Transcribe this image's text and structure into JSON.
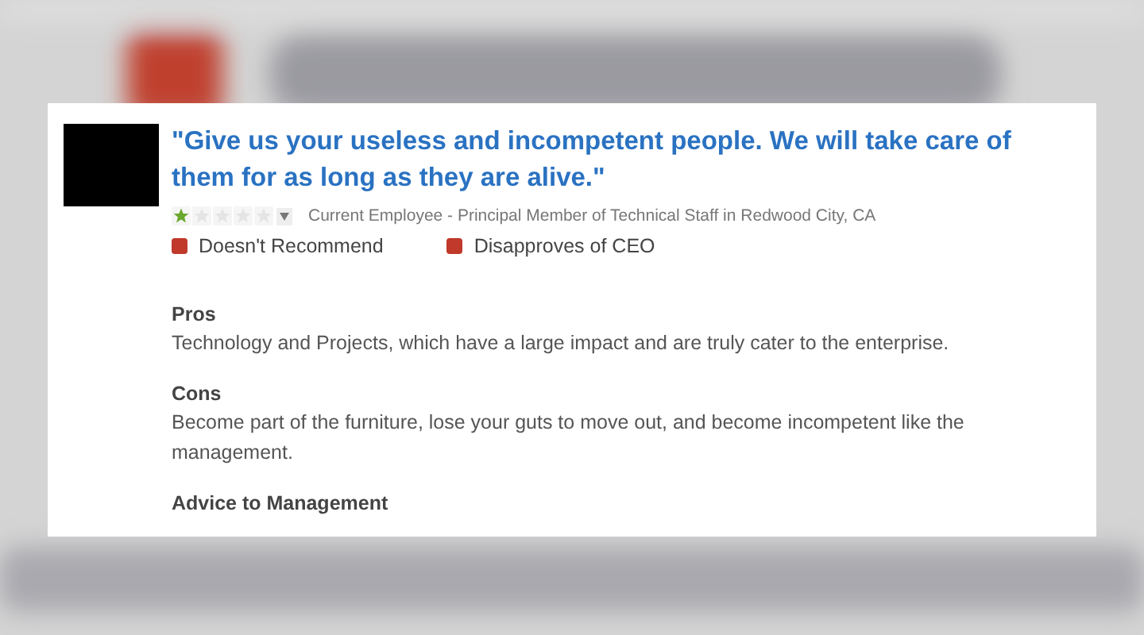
{
  "review": {
    "title": "\"Give us your useless and incompetent people. We will take care of them for as long as they are alive.\"",
    "stars": 1,
    "author": "Current Employee - Principal Member of Technical Staff in Redwood City, CA",
    "flags": [
      "Doesn't Recommend",
      "Disapproves of CEO"
    ],
    "sections": [
      {
        "heading": "Pros",
        "body": "Technology and Projects, which have a large impact and are truly cater to the enterprise."
      },
      {
        "heading": "Cons",
        "body": "Become part of the furniture, lose your guts to move out, and become incompetent like the management."
      },
      {
        "heading": "Advice to Management"
      }
    ]
  }
}
